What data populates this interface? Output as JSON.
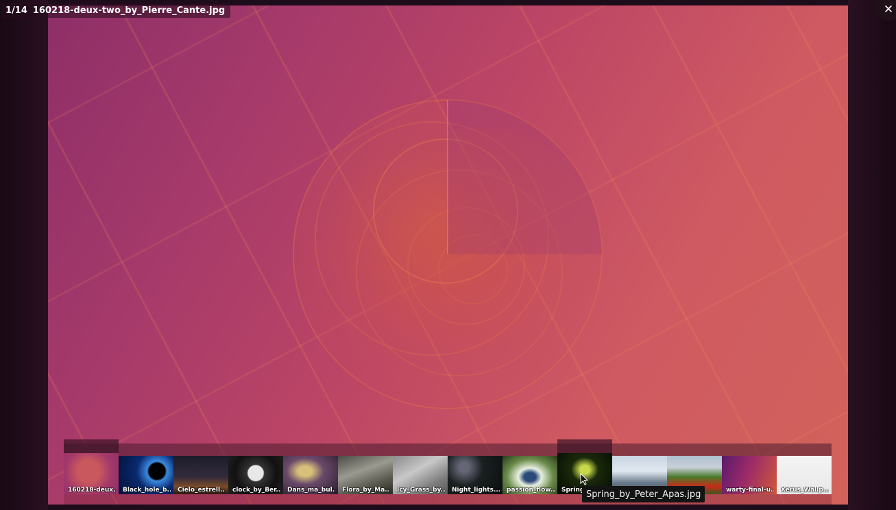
{
  "viewer": {
    "counter": "1/14",
    "filename": "160218-deux-two_by_Pierre_Cante.jpg",
    "close_icon": "close-icon"
  },
  "thumbnails": [
    {
      "caption": "160218-deux..."
    },
    {
      "caption": "Black_hole_b..."
    },
    {
      "caption": "Cielo_estrell..."
    },
    {
      "caption": "clock_by_Ber..."
    },
    {
      "caption": "Dans_ma_bul..."
    },
    {
      "caption": "Flora_by_Ma..."
    },
    {
      "caption": "Icy_Grass_by..."
    },
    {
      "caption": "Night_lights..."
    },
    {
      "caption": "passion_flow..."
    },
    {
      "caption": "Spring_by_P..."
    },
    {
      "caption": ""
    },
    {
      "caption": "..."
    },
    {
      "caption": "warty-final-u..."
    },
    {
      "caption": "Xerus_Wallp..."
    }
  ],
  "tooltip": "Spring_by_Peter_Apas.jpg",
  "colors": {
    "backdrop": "#1d0c1a",
    "wallpaper_magenta": "#a4396a",
    "wallpaper_orange": "#d2625a"
  }
}
